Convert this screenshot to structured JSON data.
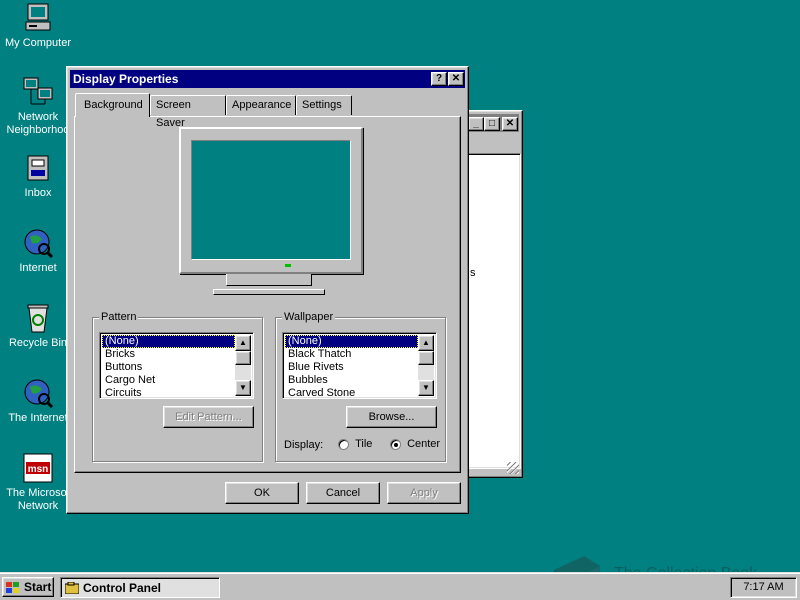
{
  "desktop": {
    "icons": [
      {
        "label": "My Computer",
        "icon": "my-computer-icon"
      },
      {
        "label": "Network\nNeighborhoo",
        "icon": "network-neighborhood-icon"
      },
      {
        "label": "Inbox",
        "icon": "inbox-icon"
      },
      {
        "label": "Internet",
        "icon": "internet-icon"
      },
      {
        "label": "Recycle Bin",
        "icon": "recycle-bin-icon"
      },
      {
        "label": "The Internet",
        "icon": "internet-globe-icon"
      },
      {
        "label": "The Microsof\nNetwork",
        "icon": "msn-icon"
      }
    ],
    "background_color": "#008080"
  },
  "dialog": {
    "title": "Display Properties",
    "help_button": "?",
    "close_button": "✕",
    "tabs": [
      "Background",
      "Screen Saver",
      "Appearance",
      "Settings"
    ],
    "active_tab": "Background",
    "pattern": {
      "legend": "Pattern",
      "items": [
        "(None)",
        "Bricks",
        "Buttons",
        "Cargo Net",
        "Circuits"
      ],
      "selected": "(None)",
      "edit_button": "Edit Pattern..."
    },
    "wallpaper": {
      "legend": "Wallpaper",
      "items": [
        "(None)",
        "Black Thatch",
        "Blue Rivets",
        "Bubbles",
        "Carved Stone"
      ],
      "selected": "(None)",
      "browse_button": "Browse...",
      "display_label": "Display:",
      "options": [
        "Tile",
        "Center"
      ],
      "selected_option": "Center"
    },
    "ok_button": "OK",
    "cancel_button": "Cancel",
    "apply_button": "Apply"
  },
  "background_window": {
    "partial_text": "s"
  },
  "taskbar": {
    "start_label": "Start",
    "task_label": "Control Panel",
    "clock": "7:17 AM"
  },
  "watermark": "The Collection Book"
}
